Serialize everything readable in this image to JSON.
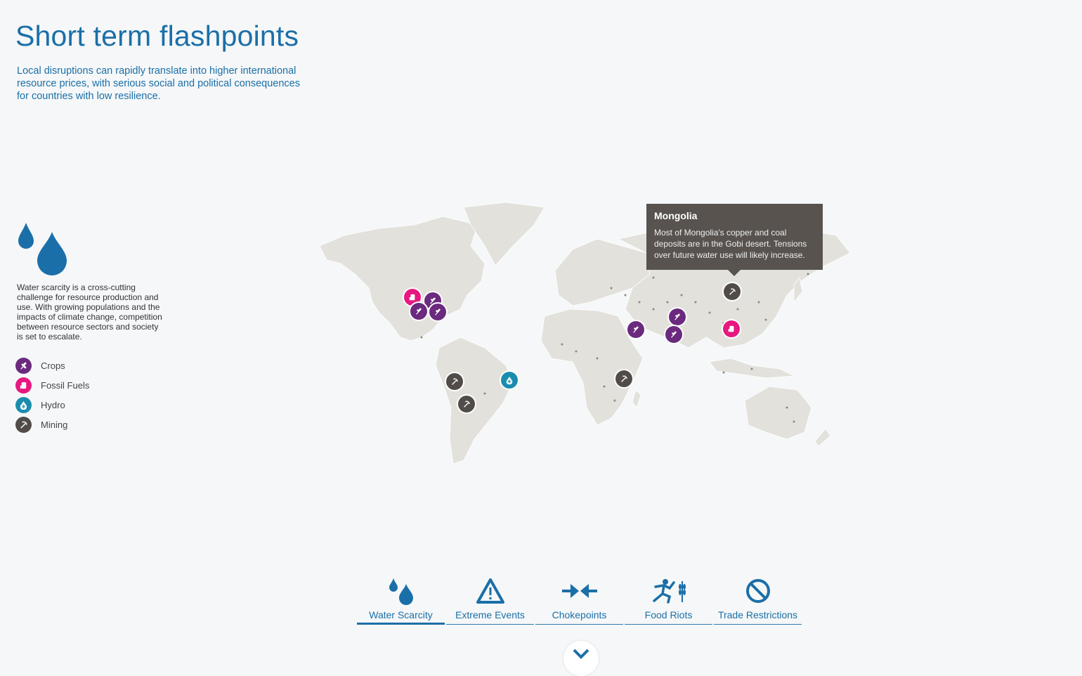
{
  "header": {
    "title": "Short term flashpoints",
    "subtitle": "Local disruptions can rapidly translate into higher international resource prices, with serious social and political consequences for countries with low resilience."
  },
  "sidebar": {
    "icon": "water-drops-icon",
    "description": "Water scarcity is a cross-cutting challenge for resource production and use. With growing populations and the impacts of climate change, competition between resource sectors and society is set to escalate.",
    "legend": [
      {
        "label": "Crops",
        "color": "#6b2a7e",
        "icon": "wheat-icon"
      },
      {
        "label": "Fossil Fuels",
        "color": "#e5197f",
        "icon": "oil-pump-icon"
      },
      {
        "label": "Hydro",
        "color": "#1a8dae",
        "icon": "hydro-icon"
      },
      {
        "label": "Mining",
        "color": "#514c49",
        "icon": "pickaxe-icon"
      }
    ]
  },
  "tooltip": {
    "title": "Mongolia",
    "text": "Most of Mongolia's copper and coal deposits are in the Gobi desert. Tensions over future water use will likely increase."
  },
  "tabs": [
    {
      "label": "Water Scarcity",
      "icon": "water-drops-icon",
      "active": true
    },
    {
      "label": "Extreme Events",
      "icon": "warning-triangle-icon",
      "active": false
    },
    {
      "label": "Chokepoints",
      "icon": "converging-arrows-icon",
      "active": false
    },
    {
      "label": "Food Riots",
      "icon": "running-figure-icon",
      "active": false
    },
    {
      "label": "Trade Restrictions",
      "icon": "prohibited-icon",
      "active": false
    }
  ],
  "colors": {
    "accent": "#1b6fa8",
    "crops": "#6b2a7e",
    "fossil": "#e5197f",
    "hydro": "#1a8dae",
    "mining": "#514c49"
  }
}
